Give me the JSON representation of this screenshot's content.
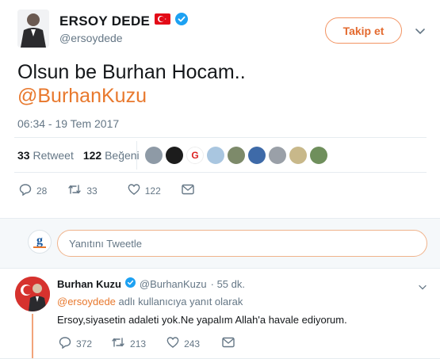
{
  "tweet": {
    "author_name": "ERSOY DEDE",
    "author_handle": "@ersoydede",
    "follow_label": "Takip et",
    "text": "Olsun be Burhan Hocam..",
    "mention": "@BurhanKuzu",
    "timestamp": "06:34 - 19 Tem 2017",
    "retweet_count": "33",
    "retweet_label": "Retweet",
    "like_count": "122",
    "like_label": "Beğeni",
    "actions": {
      "reply": "28",
      "retweet": "33",
      "like": "122"
    }
  },
  "reply_box": {
    "placeholder": "Yanıtını Tweetle"
  },
  "reply": {
    "author_name": "Burhan Kuzu",
    "author_handle": "@BurhanKuzu",
    "age": "· 55 dk.",
    "reply_to_mention": "@ersoydede",
    "reply_to_suffix": "adlı kullanıcıya yanıt olarak",
    "text": "Ersoy,siyasetin adaleti yok.Ne yapalım Allah'a havale ediyorum.",
    "actions": {
      "reply": "372",
      "retweet": "213",
      "like": "243"
    }
  },
  "colors": {
    "accent": "#e8782d",
    "verified": "#1da1f2",
    "muted": "#657786"
  }
}
